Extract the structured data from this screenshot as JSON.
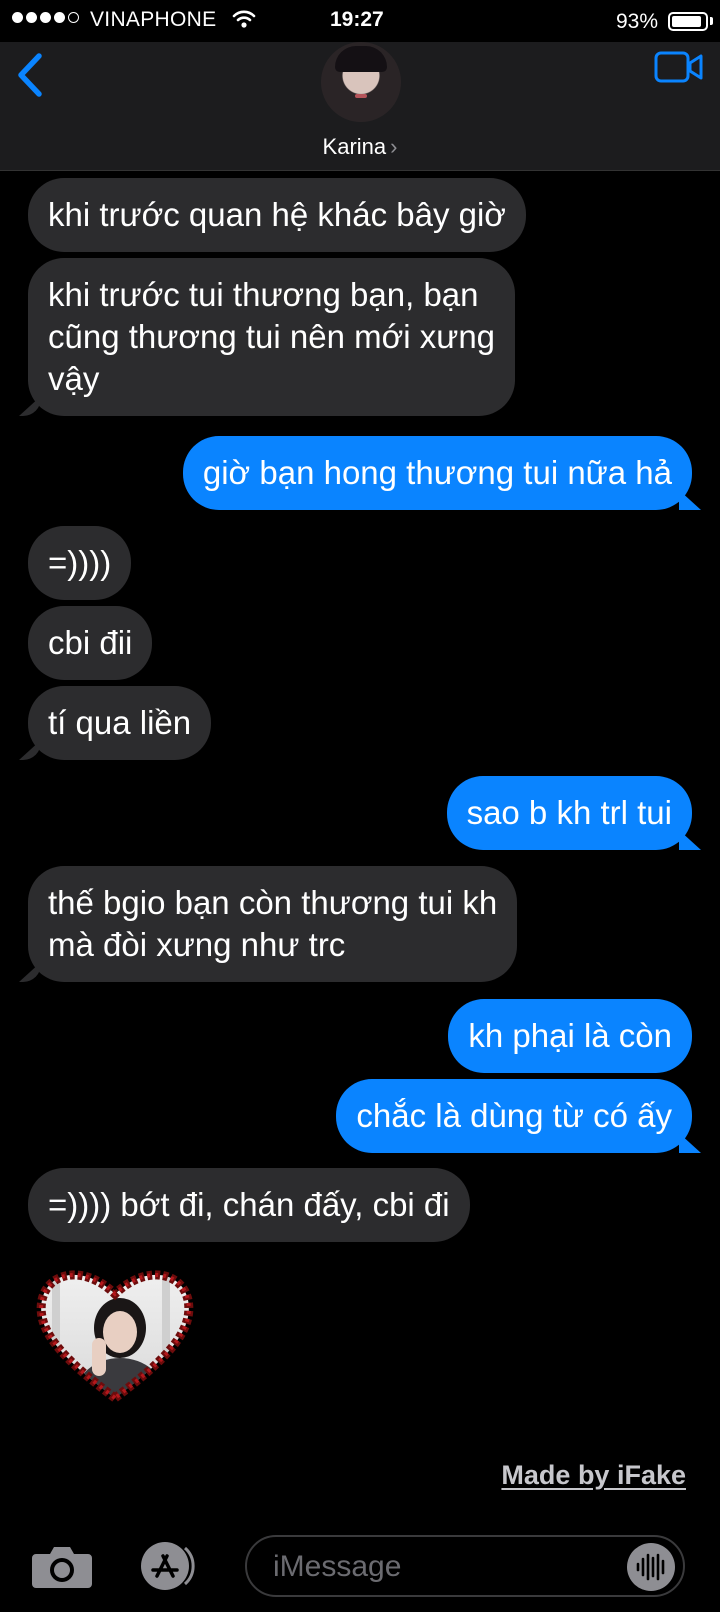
{
  "status_bar": {
    "carrier": "VINAPHONE",
    "time": "19:27",
    "battery_percent": "93%",
    "battery_level": 0.93
  },
  "nav": {
    "contact_name": "Karina",
    "chevron": "›"
  },
  "messages": [
    {
      "direction": "in",
      "text": [
        "khi trước quan hệ khác bây giờ"
      ]
    },
    {
      "direction": "in",
      "text": [
        "khi trước tui thương bạn, bạn",
        "cũng thương tui nên mới xưng",
        "vậy"
      ]
    },
    {
      "direction": "out",
      "text": [
        "giờ bạn hong thương tui nữa hả"
      ]
    },
    {
      "direction": "in",
      "text": [
        "=))))"
      ]
    },
    {
      "direction": "in",
      "text": [
        "cbi đii"
      ]
    },
    {
      "direction": "in",
      "text": [
        "tí qua liền"
      ]
    },
    {
      "direction": "out",
      "text": [
        "sao b kh trl tui"
      ]
    },
    {
      "direction": "in",
      "text": [
        "thế bgio bạn còn thương tui kh",
        "mà đòi xưng như trc"
      ]
    },
    {
      "direction": "out",
      "text": [
        "kh phại là còn"
      ]
    },
    {
      "direction": "out",
      "text": [
        "chắc là dùng từ có ấy"
      ]
    },
    {
      "direction": "in",
      "text": [
        "=)))) bớt đi, chán đấy, cbi đi"
      ]
    }
  ],
  "watermark": "Made by iFake",
  "input": {
    "placeholder": "iMessage"
  },
  "colors": {
    "outgoing": "#0a84ff",
    "incoming": "#2c2c2e",
    "background": "#000000",
    "accent": "#0a84ff"
  },
  "icons": [
    "signal-dots-icon",
    "wifi-icon",
    "battery-icon",
    "back-chevron-icon",
    "video-camera-icon",
    "camera-icon",
    "app-store-icon",
    "audio-waveform-icon"
  ]
}
